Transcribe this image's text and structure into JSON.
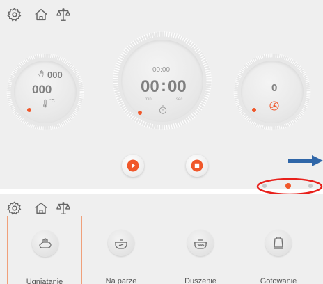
{
  "colors": {
    "accent": "#f0572a",
    "panel_bg": "#efefef",
    "text_grey": "#8a8a8a",
    "arrow_blue": "#2f66a8",
    "annotation_red": "#e8201b"
  },
  "top_screen": {
    "toolbar": {
      "icons": [
        "gear-icon",
        "home-icon",
        "scale-icon"
      ]
    },
    "left_dial": {
      "hand_value": "000",
      "main_value": "000",
      "temp_unit": "°C"
    },
    "center_dial": {
      "time_small": "00:00",
      "minutes": "00",
      "separator": ":",
      "seconds": "00",
      "min_label": "min",
      "sec_label": "sec"
    },
    "right_dial": {
      "value": "0"
    },
    "controls": {
      "play": "play-icon",
      "stop": "stop-icon"
    },
    "pagination": {
      "pages": 3,
      "current": 2
    }
  },
  "bottom_screen": {
    "toolbar": {
      "icons": [
        "gear-icon",
        "home-icon",
        "scale-icon"
      ]
    },
    "modes": [
      {
        "label": "Ugniatanie",
        "icon": "kneading-hand-icon",
        "selected": true
      },
      {
        "label": "Na parze",
        "icon": "steamer-pot-icon",
        "selected": false
      },
      {
        "label": "Duszenie",
        "icon": "stew-pot-icon",
        "selected": false
      },
      {
        "label": "Gotowanie",
        "icon": "kettle-icon",
        "selected": false
      }
    ]
  }
}
